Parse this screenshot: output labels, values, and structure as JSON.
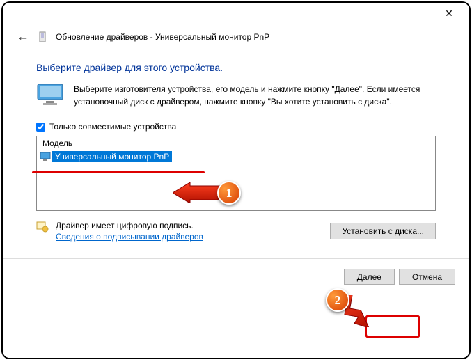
{
  "titlebar": {
    "close": "✕"
  },
  "header": {
    "back": "←",
    "title": "Обновление драйверов - Универсальный монитор PnP"
  },
  "main": {
    "heading": "Выберите драйвер для этого устройства.",
    "info": "Выберите изготовителя устройства, его модель и нажмите кнопку \"Далее\". Если имеется установочный диск с  драйвером, нажмите кнопку \"Вы хотите установить с диска\".",
    "compat_checkbox_label": "Только совместимые устройства",
    "list_header": "Модель",
    "list_items": [
      "Универсальный монитор PnP"
    ],
    "signature_text": "Драйвер имеет цифровую подпись.",
    "signature_link": "Сведения о подписывании драйверов",
    "install_from_disk": "Установить с диска..."
  },
  "footer": {
    "next": "Далее",
    "cancel": "Отмена"
  },
  "annotations": {
    "badge1": "1",
    "badge2": "2"
  }
}
